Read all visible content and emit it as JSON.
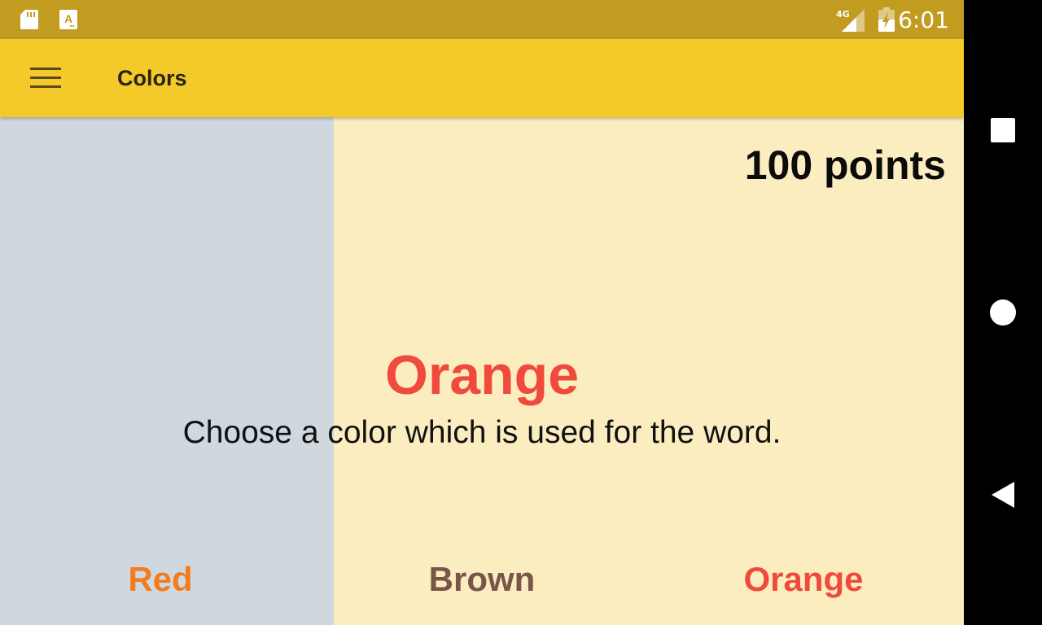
{
  "status_bar": {
    "time": "6:01",
    "network_label": "4G",
    "icons": [
      "sd-card-icon",
      "app-notification-icon",
      "signal-4g-icon",
      "battery-charging-icon"
    ],
    "color": "#C29B21"
  },
  "toolbar": {
    "title": "Colors",
    "menu_icon": "hamburger-menu-icon",
    "color": "#F4C92A"
  },
  "game": {
    "points": "100 points",
    "word": "Orange",
    "word_color": "#EF4A3C",
    "instruction": "Choose a color which is used for the word.",
    "answers": [
      {
        "label": "Red",
        "color": "#F47C1E"
      },
      {
        "label": "Brown",
        "color": "#7A5548"
      },
      {
        "label": "Orange",
        "color": "#EF4A3C"
      }
    ]
  },
  "nav_bar": {
    "buttons": [
      "recents-square-icon",
      "home-circle-icon",
      "back-triangle-icon"
    ]
  }
}
